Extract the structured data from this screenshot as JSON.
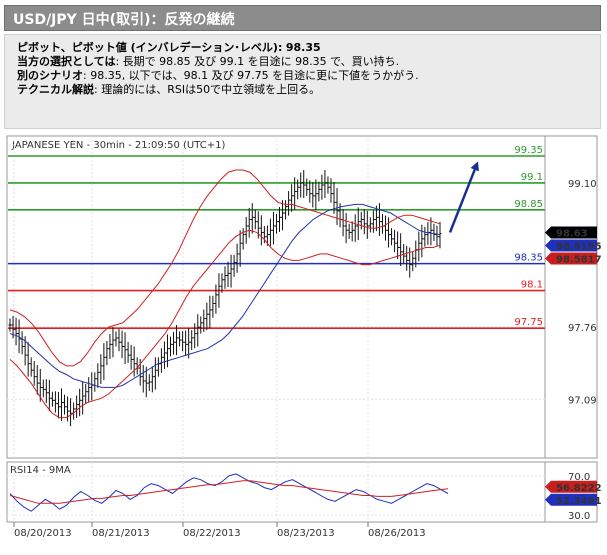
{
  "header": {
    "title": "USD/JPY 日中(取引)：反発の継続"
  },
  "description": {
    "pivot_label": "ピボット、ピボット値 (インバレデーション･レベル):",
    "pivot_value": "98.35",
    "preferred_label": "当方の選択としては",
    "preferred_text": ": 長期で 98.85 及び 99.1 を目途に 98.35 で、買い持ち.",
    "alternative_label": "別のシナリオ",
    "alternative_text": ": 98.35, 以下では、98.1 及び 97.75 を目途に更に下値をうかがう.",
    "technical_label": "テクニカル解説",
    "technical_text": ": 理論的には、RSIは50で中立領域を上回る。"
  },
  "chart_data": [
    {
      "type": "candlestick",
      "title": "JAPANESE YEN - 30min - 21:09:50 (UTC+1)",
      "x_tick_labels": [
        "08/20/2013",
        "08/21/2013",
        "08/22/2013",
        "08/23/2013",
        "08/26/2013"
      ],
      "y_tick_labels": [
        "99.10",
        "97.76",
        "97.09"
      ],
      "y_ticks": [
        99.1,
        97.76,
        97.09
      ],
      "ylim": [
        96.6,
        99.35
      ],
      "levels": [
        {
          "label": "99.35",
          "value": 99.35,
          "color": "#2a9d2a"
        },
        {
          "label": "99.1",
          "value": 99.1,
          "color": "#2a9d2a"
        },
        {
          "label": "98.85",
          "value": 98.85,
          "color": "#2a9d2a"
        },
        {
          "label": "98.35",
          "value": 98.35,
          "color": "#1f2fbf"
        },
        {
          "label": "98.1",
          "value": 98.1,
          "color": "#e02020"
        },
        {
          "label": "97.75",
          "value": 97.75,
          "color": "#e02020"
        }
      ],
      "price_badges": [
        {
          "label": "98.63",
          "value": 98.63,
          "bg": "#000000",
          "fg": "#ffffff"
        },
        {
          "label": "98.6195",
          "value": 98.6195,
          "bg": "#1f2fbf",
          "fg": "#ffffff"
        },
        {
          "label": "98.5817",
          "value": 98.5817,
          "bg": "#c81e1e",
          "fg": "#ffffff"
        }
      ],
      "series": [
        {
          "name": "price",
          "color": "#000000",
          "values": [
            97.78,
            97.74,
            97.7,
            97.65,
            97.58,
            97.5,
            97.42,
            97.36,
            97.3,
            97.24,
            97.2,
            97.18,
            97.15,
            97.1,
            97.08,
            97.05,
            97.02,
            97.06,
            97.02,
            96.98,
            96.96,
            97.0,
            97.04,
            97.08,
            97.12,
            97.16,
            97.2,
            97.22,
            97.28,
            97.34,
            97.4,
            97.48,
            97.56,
            97.6,
            97.64,
            97.66,
            97.62,
            97.58,
            97.55,
            97.5,
            97.46,
            97.42,
            97.38,
            97.3,
            97.26,
            97.24,
            97.25,
            97.3,
            97.36,
            97.42,
            97.48,
            97.52,
            97.56,
            97.6,
            97.62,
            97.66,
            97.64,
            97.62,
            97.6,
            97.62,
            97.66,
            97.7,
            97.76,
            97.8,
            97.84,
            97.88,
            97.92,
            97.98,
            98.06,
            98.14,
            98.2,
            98.24,
            98.26,
            98.3,
            98.36,
            98.44,
            98.54,
            98.62,
            98.7,
            98.76,
            98.78,
            98.74,
            98.68,
            98.64,
            98.6,
            98.62,
            98.66,
            98.7,
            98.74,
            98.78,
            98.82,
            98.88,
            98.94,
            98.98,
            99.02,
            99.06,
            99.1,
            99.08,
            99.04,
            99.0,
            98.98,
            99.0,
            99.04,
            99.08,
            99.1,
            99.06,
            99.0,
            98.92,
            98.84,
            98.76,
            98.7,
            98.66,
            98.64,
            98.66,
            98.7,
            98.74,
            98.76,
            98.72,
            98.7,
            98.72,
            98.76,
            98.78,
            98.74,
            98.7,
            98.66,
            98.62,
            98.58,
            98.54,
            98.5,
            98.46,
            98.42,
            98.38,
            98.34,
            98.4,
            98.48,
            98.54,
            98.58,
            98.62,
            98.64,
            98.66,
            98.62,
            98.6,
            98.63
          ]
        },
        {
          "name": "ma",
          "color": "#2233aa",
          "values": [
            97.7,
            97.68,
            97.64,
            97.58,
            97.52,
            97.46,
            97.4,
            97.35,
            97.32,
            97.28,
            97.26,
            97.24,
            97.22,
            97.2,
            97.2,
            97.2,
            97.22,
            97.26,
            97.3,
            97.34,
            97.38,
            97.42,
            97.44,
            97.46,
            97.48,
            97.5,
            97.52,
            97.54,
            97.56,
            97.6,
            97.64,
            97.7,
            97.78,
            97.86,
            97.96,
            98.06,
            98.16,
            98.26,
            98.36,
            98.46,
            98.56,
            98.64,
            98.7,
            98.76,
            98.8,
            98.84,
            98.86,
            98.88,
            98.89,
            98.9,
            98.9,
            98.88,
            98.86,
            98.84,
            98.82,
            98.78,
            98.74,
            98.7,
            98.66,
            98.64,
            98.63,
            98.62
          ]
        },
        {
          "name": "upper_band",
          "color": "#cc2222",
          "values": [
            97.92,
            97.9,
            97.86,
            97.8,
            97.72,
            97.62,
            97.52,
            97.44,
            97.4,
            97.4,
            97.44,
            97.52,
            97.62,
            97.7,
            97.76,
            97.78,
            97.8,
            97.86,
            97.92,
            98.0,
            98.08,
            98.16,
            98.26,
            98.36,
            98.48,
            98.62,
            98.76,
            98.88,
            98.98,
            99.06,
            99.14,
            99.2,
            99.22,
            99.22,
            99.2,
            99.14,
            99.06,
            98.98,
            98.92,
            98.9,
            98.9,
            98.88,
            98.86,
            98.84,
            98.82,
            98.8,
            98.78,
            98.76,
            98.74,
            98.72,
            98.7,
            98.68,
            98.68,
            98.7,
            98.74,
            98.78,
            98.8,
            98.8,
            98.78,
            98.76,
            98.74,
            98.72
          ]
        },
        {
          "name": "lower_band",
          "color": "#cc2222",
          "values": [
            97.46,
            97.4,
            97.32,
            97.24,
            97.14,
            97.04,
            96.96,
            96.92,
            96.92,
            96.96,
            97.02,
            97.06,
            97.08,
            97.1,
            97.14,
            97.2,
            97.26,
            97.32,
            97.38,
            97.46,
            97.54,
            97.62,
            97.7,
            97.8,
            97.92,
            98.04,
            98.14,
            98.22,
            98.3,
            98.38,
            98.46,
            98.54,
            98.6,
            98.64,
            98.66,
            98.64,
            98.58,
            98.5,
            98.44,
            98.4,
            98.38,
            98.38,
            98.4,
            98.42,
            98.44,
            98.44,
            98.42,
            98.4,
            98.38,
            98.36,
            98.34,
            98.34,
            98.36,
            98.38,
            98.4,
            98.42,
            98.44,
            98.46,
            98.48,
            98.5,
            98.5,
            98.52
          ]
        }
      ],
      "forecast_arrow": {
        "from": 98.64,
        "to": 99.3,
        "color": "#1a2f8f"
      }
    },
    {
      "type": "line",
      "title": "RSI14 - 9MA",
      "y_tick_labels": [
        "70.0",
        "30.0"
      ],
      "y_ticks": [
        70,
        30
      ],
      "ylim": [
        25,
        80
      ],
      "price_badges": [
        {
          "label": "56.8222",
          "value": 56.8222,
          "bg": "#c81e1e",
          "fg": "#ffffff"
        },
        {
          "label": "52.3491",
          "value": 52.3491,
          "bg": "#1f2fbf",
          "fg": "#ffffff"
        }
      ],
      "series": [
        {
          "name": "RSI14",
          "color": "#1f2fbf",
          "values": [
            52,
            44,
            38,
            34,
            40,
            46,
            42,
            36,
            40,
            48,
            54,
            50,
            45,
            42,
            48,
            55,
            52,
            46,
            50,
            58,
            62,
            60,
            56,
            52,
            58,
            64,
            68,
            66,
            62,
            60,
            64,
            70,
            72,
            68,
            64,
            62,
            58,
            56,
            60,
            64,
            66,
            62,
            58,
            54,
            50,
            46,
            44,
            48,
            52,
            56,
            54,
            50,
            46,
            44,
            42,
            46,
            50,
            54,
            58,
            62,
            60,
            56,
            52
          ]
        },
        {
          "name": "9MA",
          "color": "#cc2222",
          "values": [
            50,
            48,
            46,
            44,
            42,
            42,
            42,
            42,
            43,
            44,
            45,
            46,
            47,
            47,
            48,
            49,
            50,
            50,
            51,
            52,
            53,
            54,
            55,
            56,
            57,
            58,
            59,
            60,
            61,
            61,
            62,
            63,
            64,
            65,
            65,
            64,
            63,
            62,
            61,
            60,
            60,
            59,
            58,
            57,
            56,
            55,
            54,
            53,
            52,
            51,
            50,
            50,
            49,
            49,
            49,
            50,
            51,
            52,
            53,
            54,
            55,
            56,
            56.8
          ]
        }
      ]
    }
  ]
}
